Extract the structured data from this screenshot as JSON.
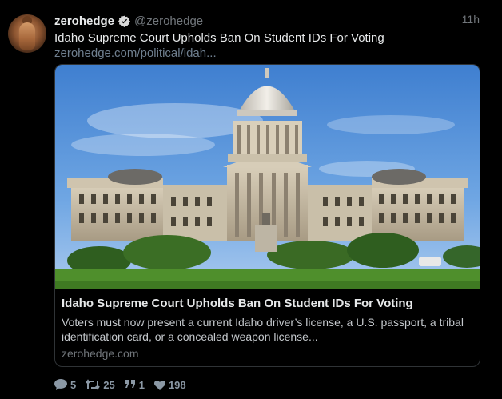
{
  "tweet": {
    "name": "zerohedge",
    "handle": "@zerohedge",
    "time": "11h",
    "text": "Idaho Supreme Court Upholds Ban On Student IDs For Voting",
    "link": "zerohedge.com/political/idah..."
  },
  "card": {
    "title": "Idaho Supreme Court Upholds Ban On Student IDs For Voting",
    "description": "Voters must now present a current Idaho driver’s license, a U.S. passport, a tribal identification card, or a concealed weapon license...",
    "domain": "zerohedge.com"
  },
  "actions": {
    "replies": "5",
    "retweets": "25",
    "quotes": "1",
    "likes": "198"
  },
  "colors": {
    "background": "#000000",
    "verified": "#d9d9d9",
    "muted": "#71767b"
  },
  "icons": [
    "verified-badge-icon",
    "reply-icon",
    "retweet-icon",
    "quote-icon",
    "heart-icon"
  ]
}
